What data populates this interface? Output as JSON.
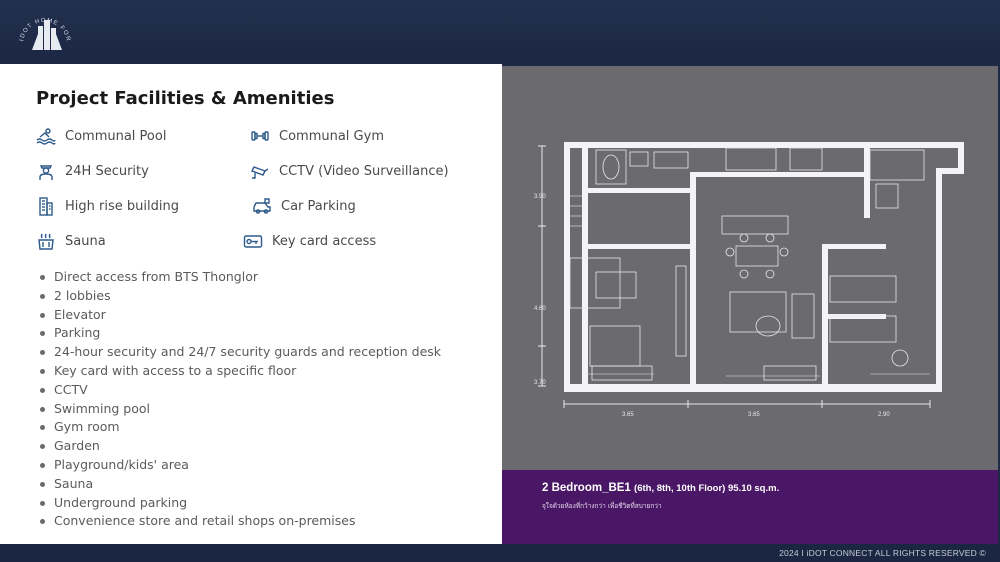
{
  "logo": {
    "arc_text": "IDOT HOME FOR RENT"
  },
  "facilities": {
    "title": "Project Facilities & Amenities",
    "amenities": [
      {
        "label": "Communal Pool",
        "icon": "pool-icon"
      },
      {
        "label": "Communal Gym",
        "icon": "dumbbell-icon"
      },
      {
        "label": "24H Security",
        "icon": "security-guard-icon"
      },
      {
        "label": "CCTV (Video Surveillance)",
        "icon": "cctv-icon"
      },
      {
        "label": "High rise building",
        "icon": "building-icon"
      },
      {
        "label": "Car Parking",
        "icon": "car-icon"
      },
      {
        "label": "Sauna",
        "icon": "sauna-icon"
      },
      {
        "label": "Key card access",
        "icon": "key-card-icon"
      }
    ],
    "list": [
      "Direct access from BTS Thonglor",
      "2 lobbies",
      "Elevator",
      "Parking",
      "24-hour security and 24/7 security guards and reception desk",
      "Key card with access to a specific floor",
      "CCTV",
      "Swimming pool",
      "Gym room",
      "Garden",
      "Playground/kids' area",
      "Sauna",
      "Underground parking",
      "Convenience store and retail shops on-premises"
    ]
  },
  "floorplan": {
    "dim_left": [
      "3.90",
      "4.60",
      "3.70"
    ],
    "dim_bottom": [
      "3.65",
      "3.65",
      "2.90"
    ],
    "caption_title": "2 Bedroom_BE1",
    "caption_detail": "(6th, 8th, 10th Floor) 95.10 sq.m.",
    "caption_sub": "จุใจด้วยห้องที่กว้างกว่า เพื่อชีวิตที่สบายกว่า"
  },
  "footer": {
    "text": "2024 I iDOT CONNECT  ALL  RIGHTS RESERVED  ©"
  },
  "colors": {
    "header": "#1e2a44",
    "caption_bg": "#4a1766",
    "plan_bg": "#6b6a6f",
    "icon": "#2d5a8a"
  }
}
